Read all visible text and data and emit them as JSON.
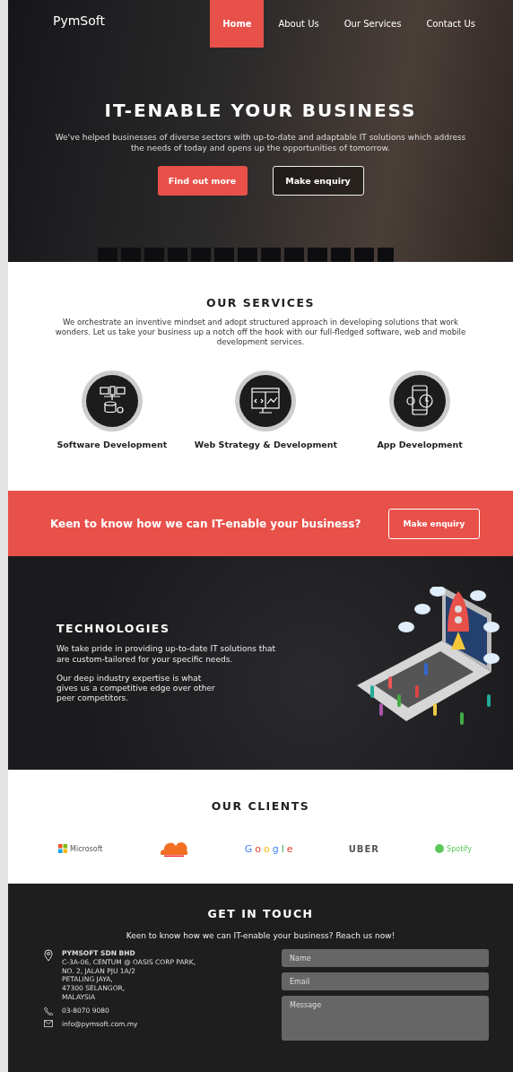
{
  "brand": "PymSoft",
  "nav": [
    {
      "label": "Home",
      "selected": true
    },
    {
      "label": "About Us",
      "selected": false
    },
    {
      "label": "Our Services",
      "selected": false
    },
    {
      "label": "Contact Us",
      "selected": false
    }
  ],
  "hero": {
    "title": "IT-ENABLE YOUR BUSINESS",
    "text": "We've helped businesses of diverse sectors with up-to-date and adaptable IT solutions which address the needs of today and opens up the opportunities of tomorrow.",
    "buttons": [
      {
        "label": "Find out more",
        "kind": "filled"
      },
      {
        "label": "Make enquiry",
        "kind": "outline"
      }
    ]
  },
  "services": {
    "title": "OUR SERVICES",
    "text": "We orchestrate an inventive mindset and adopt structured approach in developing solutions that work wonders. Let us take your business up a notch off the hook with our full-fledged software, web and mobile development services.",
    "items": [
      {
        "label": "Software Development",
        "kind": "software"
      },
      {
        "label": "Web Strategy & Development",
        "kind": "web"
      },
      {
        "label": "App Development",
        "kind": "app"
      }
    ]
  },
  "cta": {
    "text": "Keen to know how we can IT-enable your business?",
    "button": "Make enquiry"
  },
  "technologies": {
    "title": "TECHNOLOGIES",
    "paragraphs": [
      "We take pride in providing up-to-date IT solutions that are custom-tailored for your specific needs.",
      "Our deep industry expertise is what gives us a competitive edge over other peer competitors."
    ]
  },
  "clients": {
    "title": "OUR CLIENTS",
    "items": [
      {
        "kind": "squares",
        "name": "Microsoft"
      },
      {
        "kind": "cloud"
      },
      {
        "kind": "google",
        "name": "Google"
      },
      {
        "kind": "plain",
        "name": "UBER"
      },
      {
        "kind": "circle",
        "name": "Spotify"
      }
    ]
  },
  "contact": {
    "title": "GET IN TOUCH",
    "subtitle": "Keen to know how we can IT-enable your business? Reach us now!",
    "company": "PYMSOFT SDN BHD",
    "address": [
      "C-3A-06, CENTUM @ OASIS CORP PARK,",
      "NO. 2, JALAN PJU 1A/2",
      "PETALING JAYA,",
      "47300 SELANGOR,",
      "MALAYSIA"
    ],
    "phone": "03-8070 9080",
    "email": "info@pymsoft.com.my",
    "fields": [
      {
        "placeholder": "Name",
        "kind": "line"
      },
      {
        "placeholder": "Email",
        "kind": "line"
      },
      {
        "placeholder": "Message",
        "kind": "area"
      }
    ]
  }
}
